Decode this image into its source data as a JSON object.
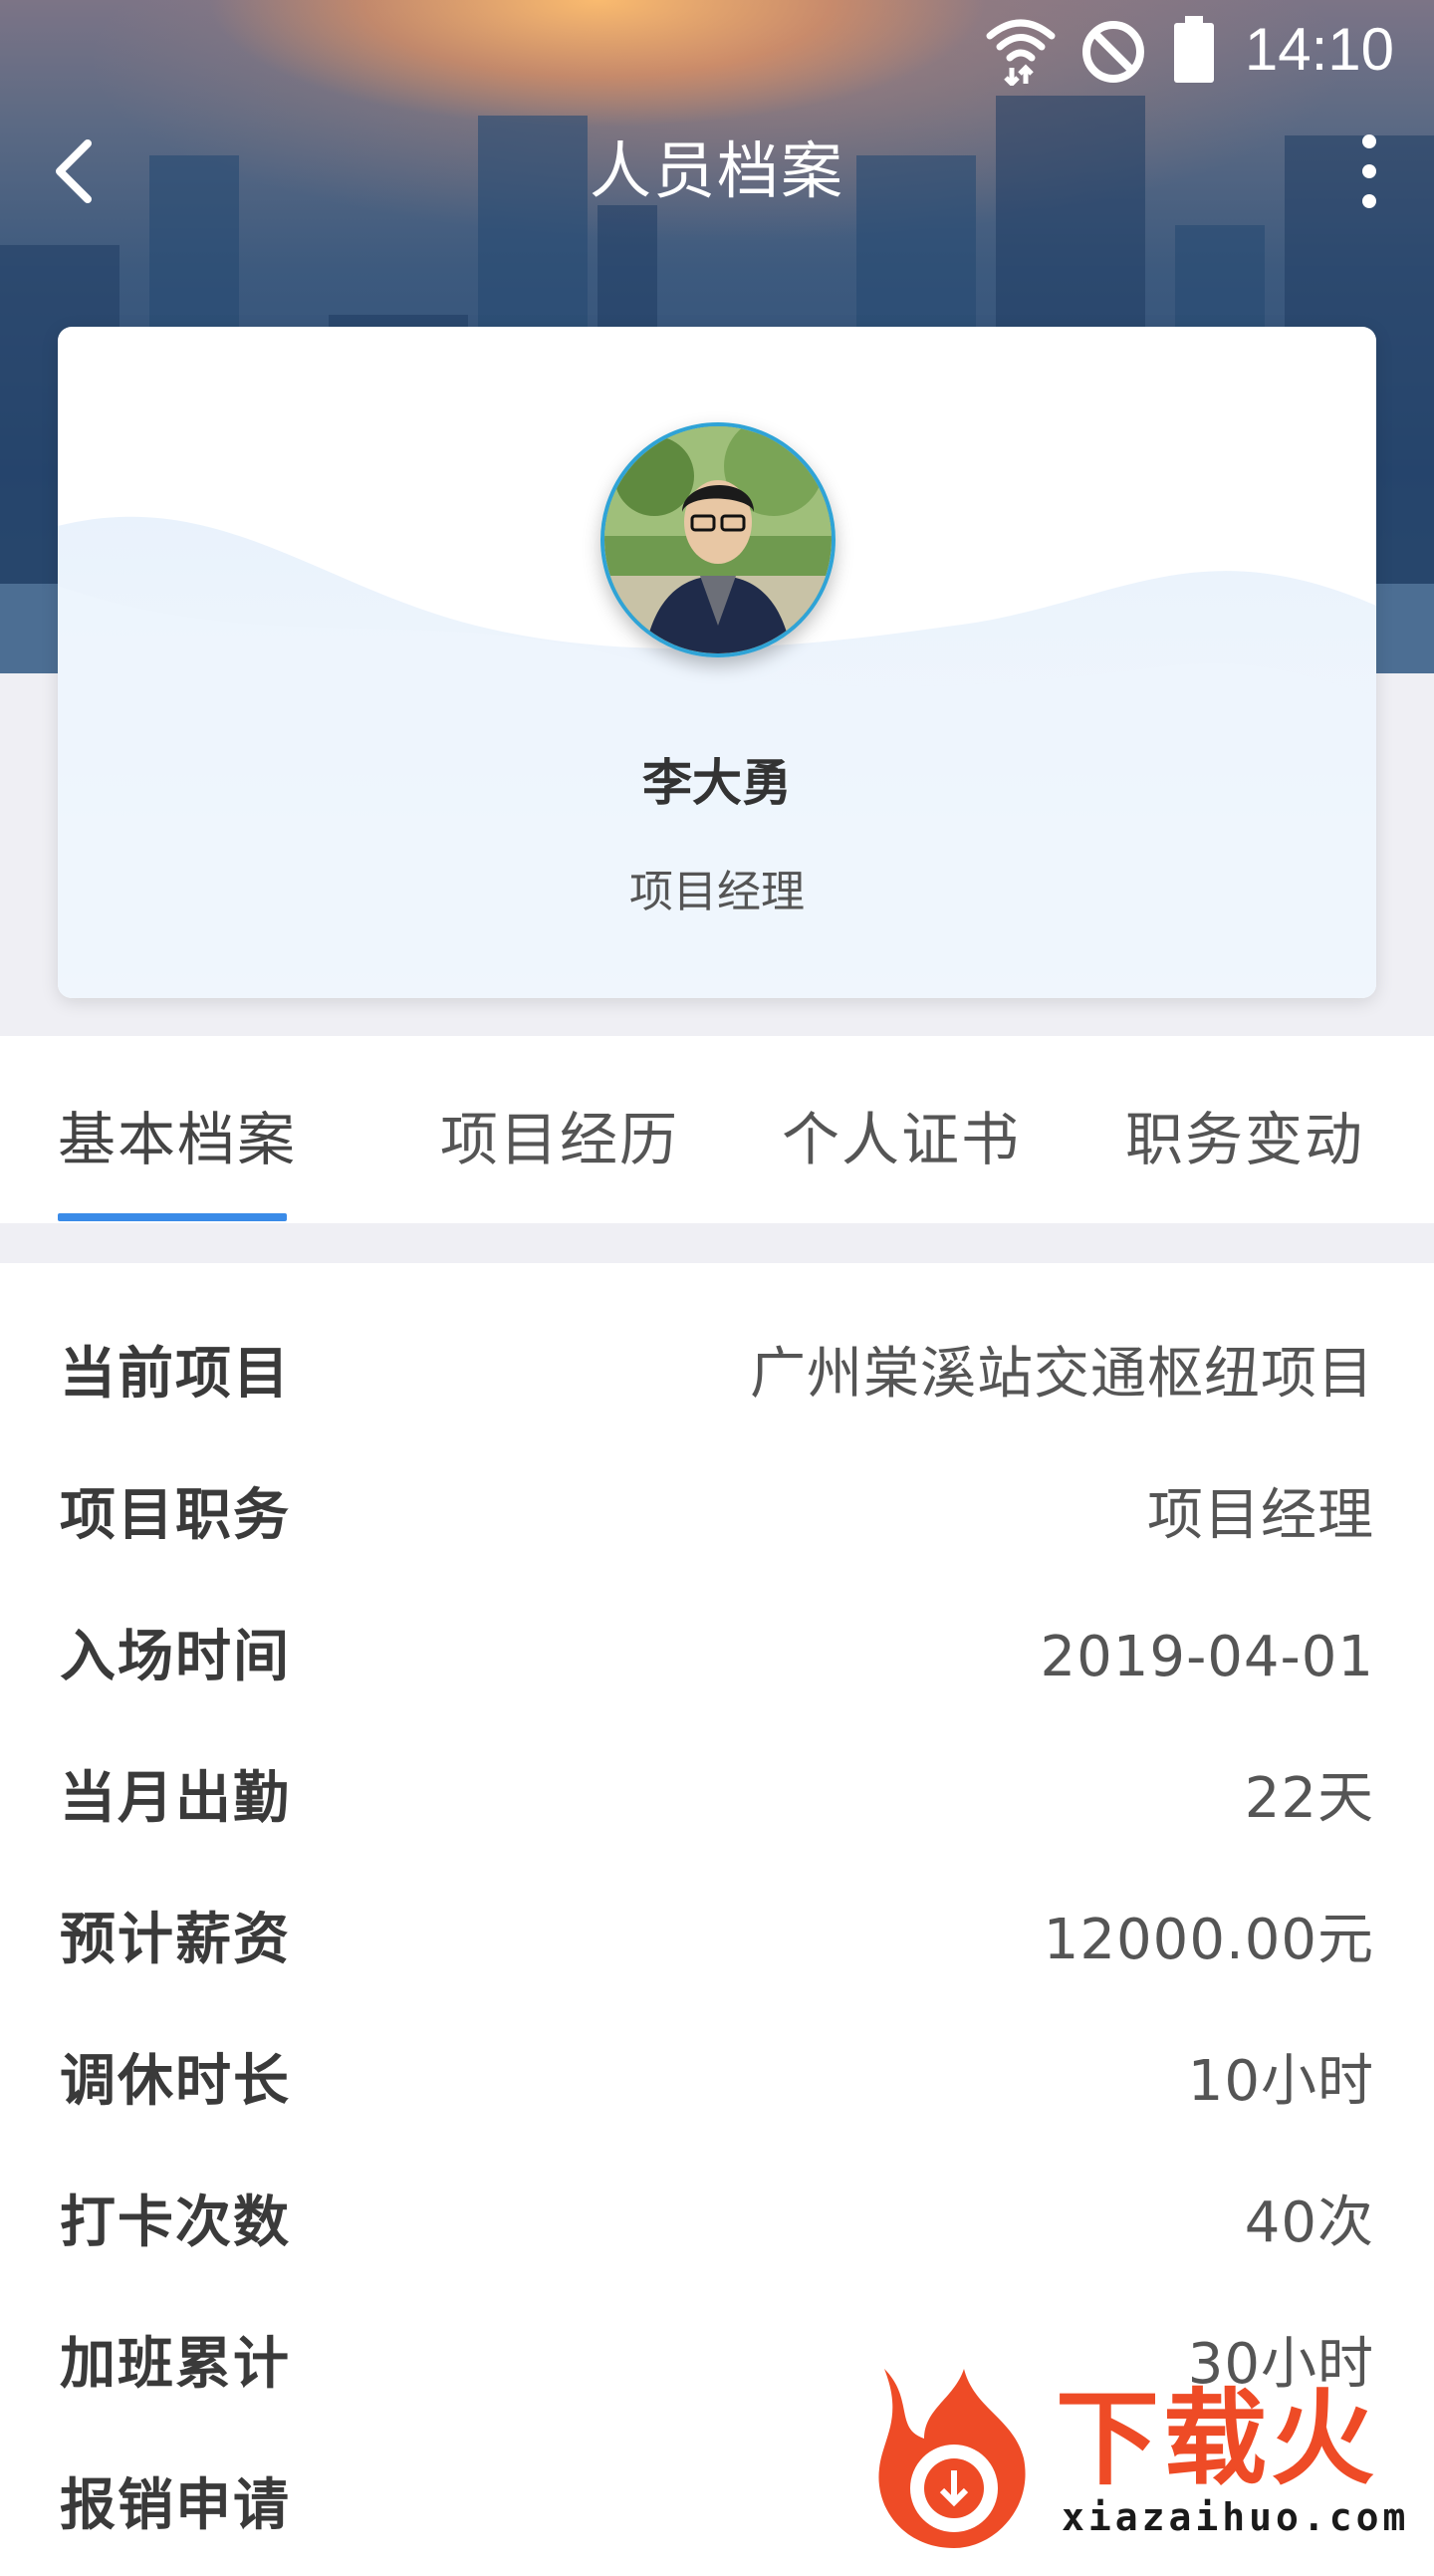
{
  "status_bar": {
    "time": "14:10",
    "icons": [
      "wifi-icon",
      "do-not-disturb-icon",
      "battery-icon"
    ]
  },
  "app_bar": {
    "title": "人员档案",
    "back_icon": "chevron-left-icon",
    "menu_icon": "more-vertical-icon"
  },
  "profile": {
    "name": "李大勇",
    "role": "项目经理",
    "avatar": "person-photo"
  },
  "tabs": [
    {
      "label": "基本档案",
      "active": true
    },
    {
      "label": "项目经历",
      "active": false
    },
    {
      "label": "个人证书",
      "active": false
    },
    {
      "label": "职务变动",
      "active": false
    }
  ],
  "info_rows": [
    {
      "label": "当前项目",
      "value": "广州棠溪站交通枢纽项目"
    },
    {
      "label": "项目职务",
      "value": "项目经理"
    },
    {
      "label": "入场时间",
      "value": "2019-04-01"
    },
    {
      "label": "当月出勤",
      "value": "22天"
    },
    {
      "label": "预计薪资",
      "value": "12000.00元"
    },
    {
      "label": "调休时长",
      "value": "10小时"
    },
    {
      "label": "打卡次数",
      "value": "40次"
    },
    {
      "label": "加班累计",
      "value": "30小时"
    },
    {
      "label": "报销申请",
      "value": ""
    }
  ],
  "watermark": {
    "brand": "下载火",
    "url": "xiazaihuo.com"
  },
  "colors": {
    "accent": "#3a8be8",
    "page_bg": "#efeff4",
    "watermark": "#ee4b26"
  }
}
